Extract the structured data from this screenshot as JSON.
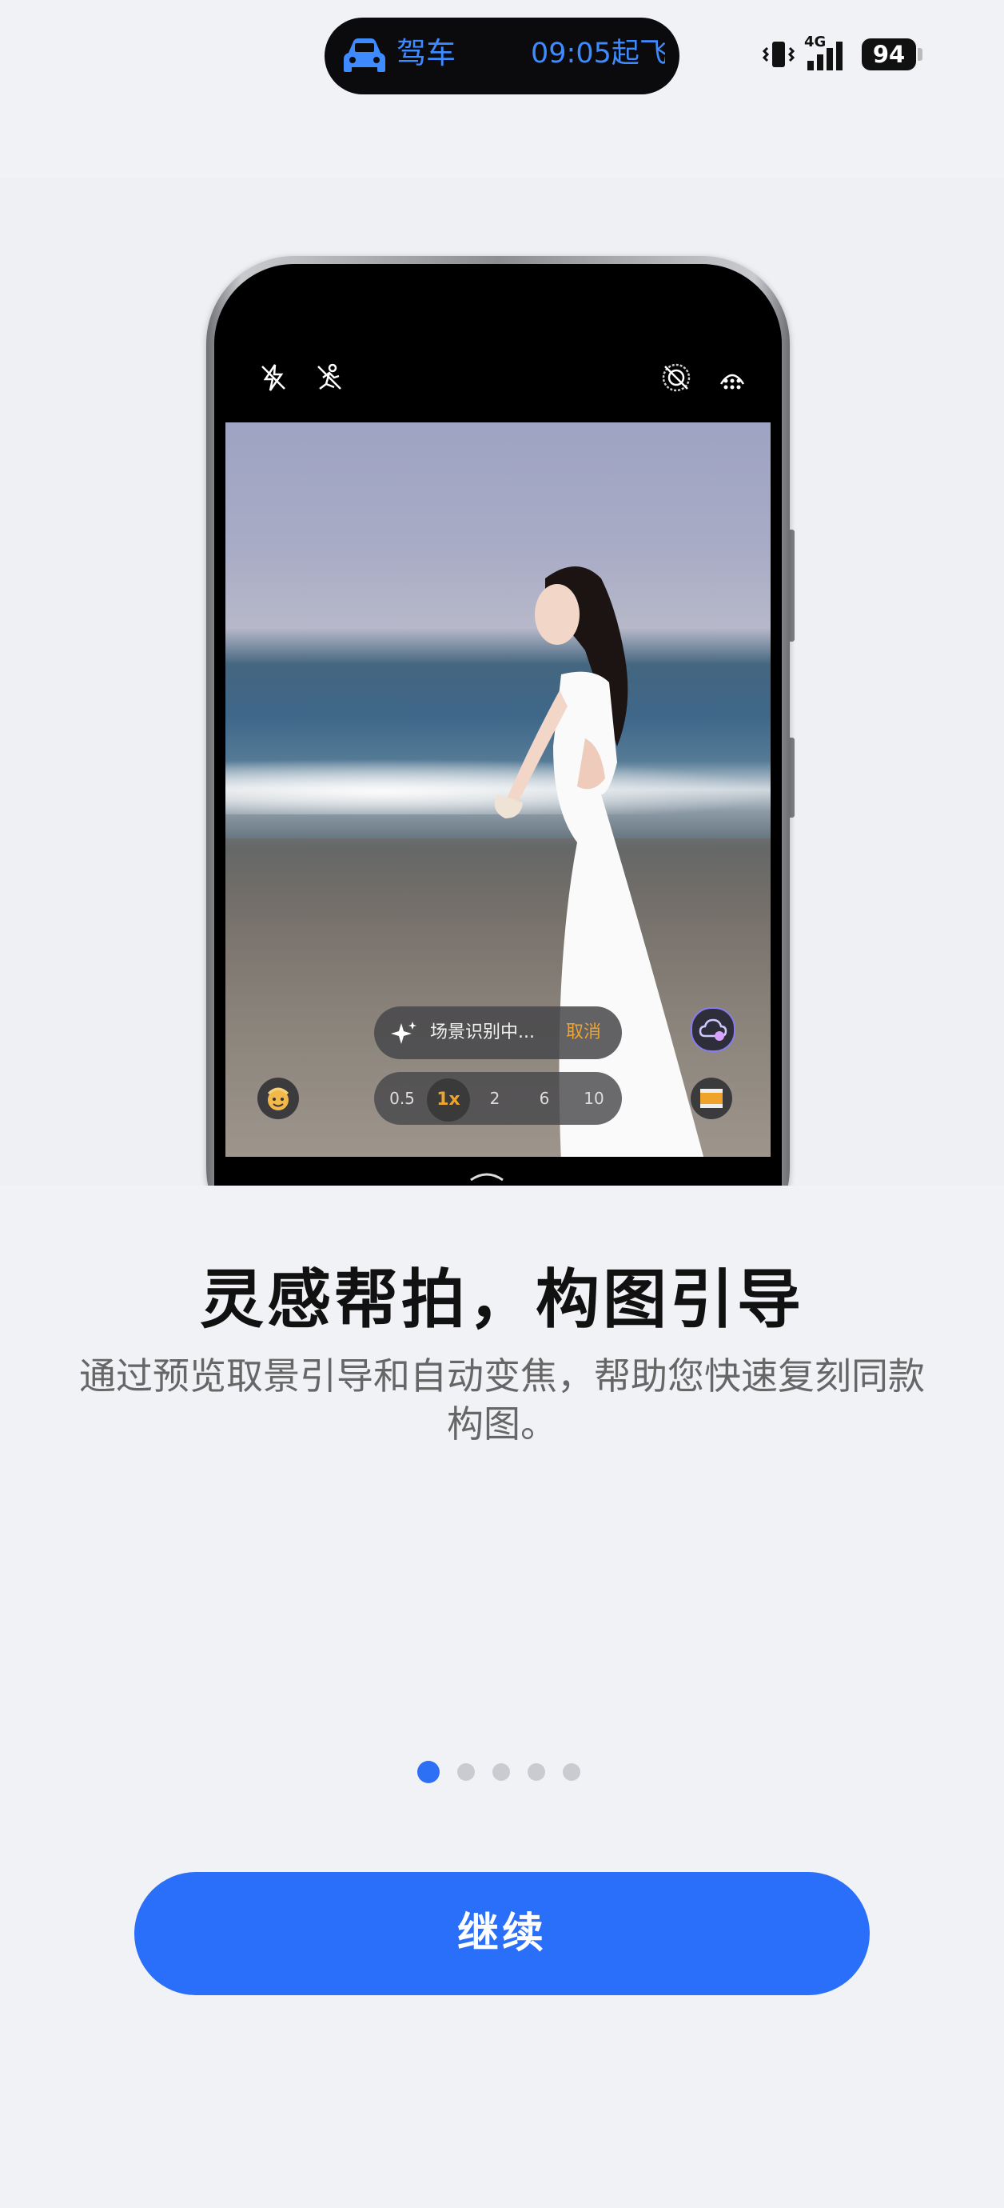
{
  "status_bar": {
    "activity_label": "驾车",
    "flight_text": "09:05起飞",
    "network": "4G",
    "battery_level": "94",
    "icons": [
      "car-icon",
      "vibrate-icon",
      "signal-icon",
      "battery-icon"
    ]
  },
  "hero": {
    "viewfinder": {
      "top_icons": [
        "flash-off-icon",
        "ai-motion-off-icon",
        "live-photo-icon",
        "more-menu-icon"
      ],
      "scene_label": "场景识别中...",
      "scene_cancel": "取消",
      "zoom_levels": [
        "0.5",
        "1x",
        "2",
        "6",
        "10"
      ],
      "zoom_selected": "1x"
    }
  },
  "main": {
    "title": "灵感帮拍，构图引导",
    "description": "通过预览取景引导和自动变焦，帮助您快速复刻同款构图。"
  },
  "pager": {
    "total": 5,
    "current": 1
  },
  "button": {
    "continue_label": "继续"
  },
  "colors": {
    "accent": "#2a6ff9",
    "island_text": "#3d8bff",
    "scene_cancel": "#f0a32a"
  }
}
